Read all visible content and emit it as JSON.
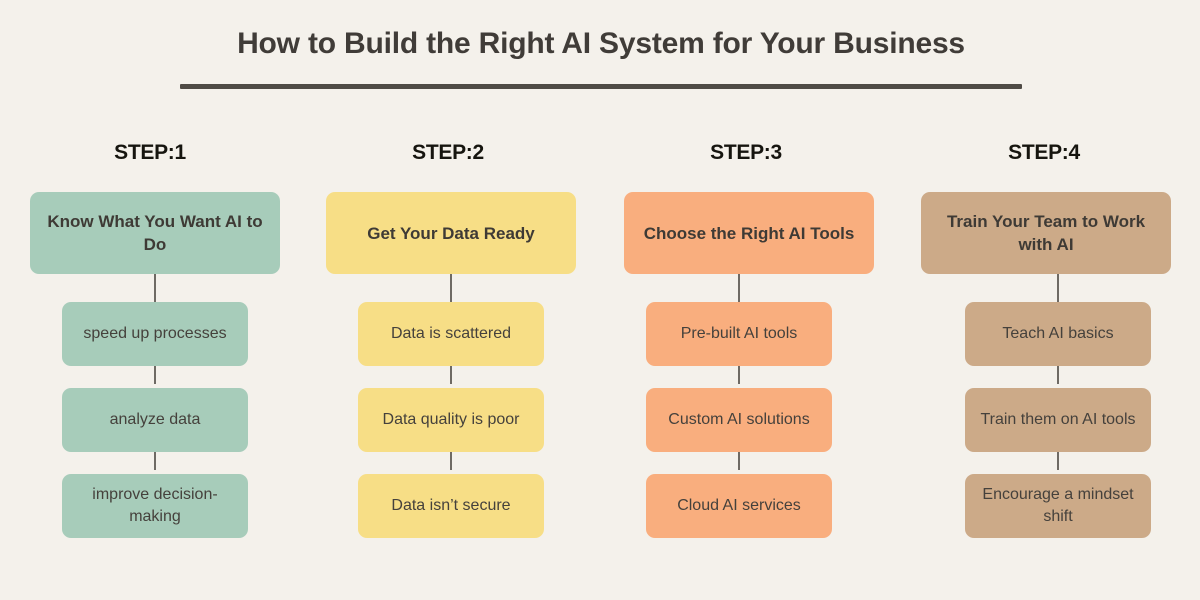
{
  "header": {
    "title": "How to Build the Right AI System for Your Business",
    "rule_color": "#4F4B45"
  },
  "background_color": "#F4F1EB",
  "connector_color": "#6E6A64",
  "columns": [
    {
      "step_label": "STEP:1",
      "color": "#A7CCBA",
      "head": "Know What You Want AI to Do",
      "items": [
        "speed up processes",
        "analyze data",
        "improve decision-making"
      ]
    },
    {
      "step_label": "STEP:2",
      "color": "#F7DE86",
      "head": "Get Your Data Ready",
      "items": [
        "Data is scattered",
        "Data quality is poor",
        "Data isn’t secure"
      ]
    },
    {
      "step_label": "STEP:3",
      "color": "#F9AE7E",
      "head": "Choose the Right AI Tools",
      "items": [
        "Pre-built AI tools",
        "Custom AI solutions",
        "Cloud AI services"
      ]
    },
    {
      "step_label": "STEP:4",
      "color": "#CCAA88",
      "head": "Train Your Team to Work with AI",
      "items": [
        "Teach AI basics",
        "Train them on AI tools",
        "Encourage a mindset shift"
      ]
    }
  ]
}
